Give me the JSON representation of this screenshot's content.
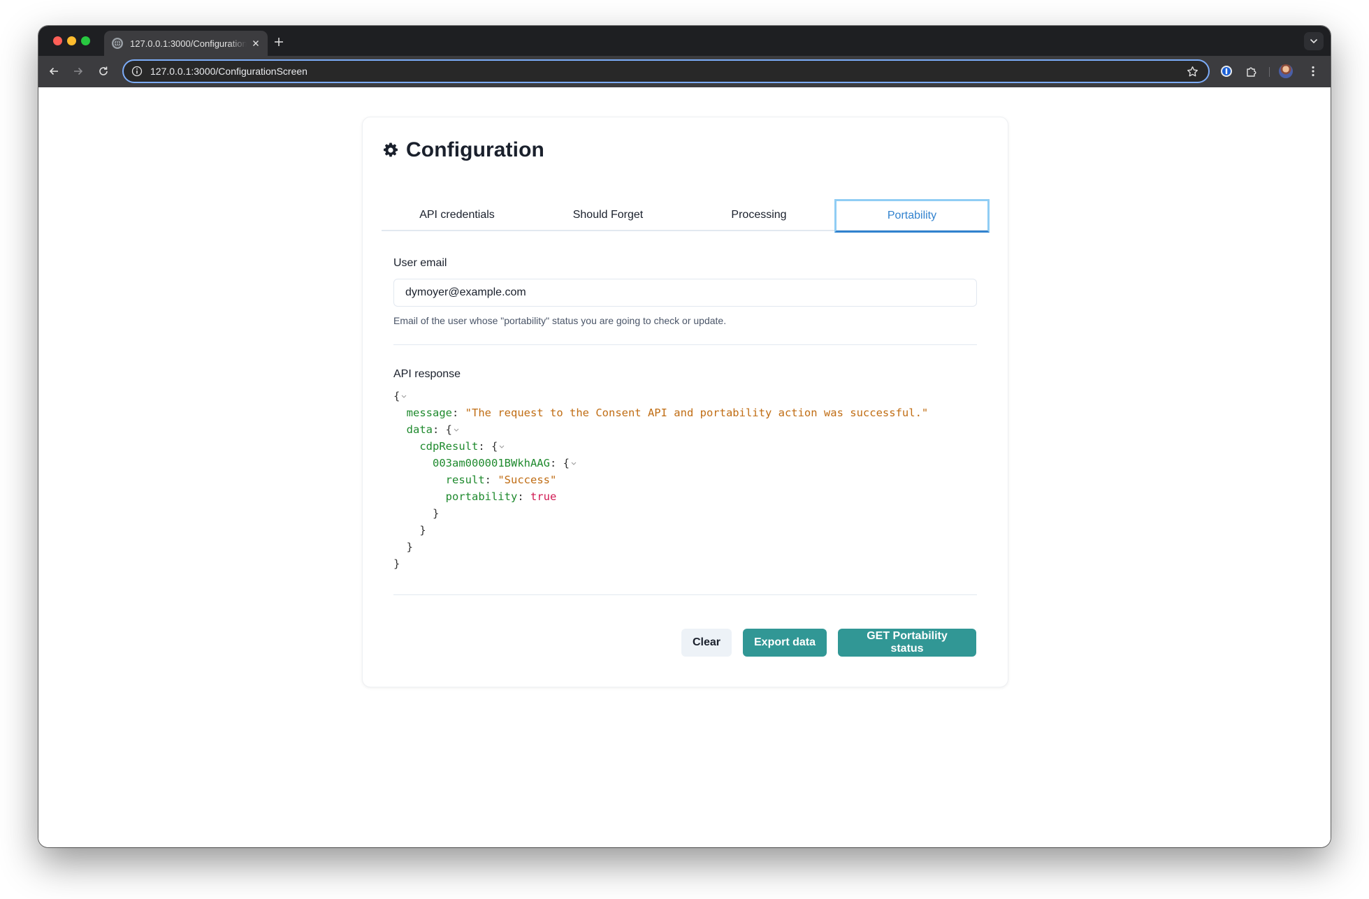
{
  "browser": {
    "tab_title": "127.0.0.1:3000/ConfigurationScreen",
    "url": "127.0.0.1:3000/ConfigurationScreen",
    "omnibox_focus_color": "#7cacf8"
  },
  "card": {
    "title": "Configuration",
    "title_icon": "gear-icon"
  },
  "tabs": [
    {
      "label": "API credentials",
      "active": false
    },
    {
      "label": "Should Forget",
      "active": false
    },
    {
      "label": "Processing",
      "active": false
    },
    {
      "label": "Portability",
      "active": true
    }
  ],
  "email": {
    "label": "User email",
    "value": "dymoyer@example.com",
    "helper": "Email of the user whose \"portability\" status you are going to check or update."
  },
  "api_response": {
    "label": "API response",
    "json": {
      "message": "The request to the Consent API and portability action was successful.",
      "data": {
        "cdpResult": {
          "003am000001BWkhAAG": {
            "result": "Success",
            "portability": true
          }
        }
      }
    }
  },
  "actions": {
    "clear_label": "Clear",
    "export_label": "Export data",
    "get_label": "GET Portability status"
  },
  "colors": {
    "accent_blue": "#3182ce",
    "teal": "#319795",
    "json_key": "#1f8a2e",
    "json_string": "#c06d14",
    "json_boolean": "#d11a53"
  }
}
